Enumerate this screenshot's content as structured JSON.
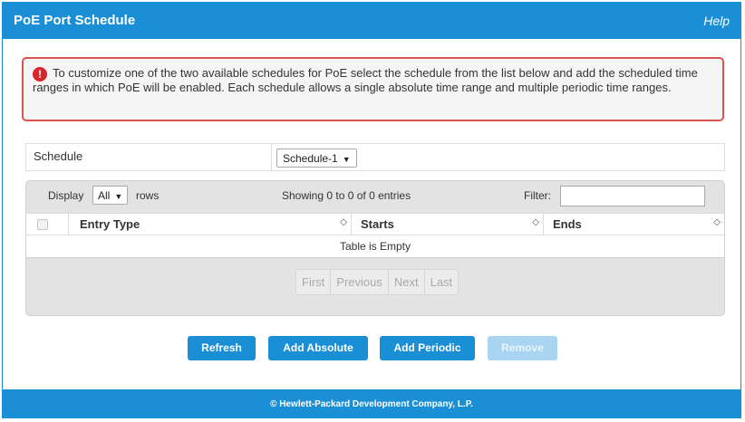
{
  "header": {
    "title": "PoE Port Schedule",
    "help": "Help"
  },
  "alert": {
    "icon": "exclamation-icon",
    "text": "To customize one of the two available schedules for PoE select the schedule from the list below and add the scheduled time ranges in which PoE will be enabled. Each schedule allows a single absolute time range and multiple periodic time ranges."
  },
  "schedule": {
    "label": "Schedule",
    "selected": "Schedule-1"
  },
  "table": {
    "display_label": "Display",
    "display_selected": "All",
    "rows_label": "rows",
    "showing": "Showing 0 to 0 of 0 entries",
    "filter_label": "Filter:",
    "filter_value": "",
    "columns": [
      "Entry Type",
      "Starts",
      "Ends"
    ],
    "empty_text": "Table is Empty",
    "pager": [
      "First",
      "Previous",
      "Next",
      "Last"
    ]
  },
  "buttons": {
    "refresh": "Refresh",
    "add_absolute": "Add Absolute",
    "add_periodic": "Add Periodic",
    "remove": "Remove"
  },
  "footer": {
    "text": "© Hewlett-Packard Development Company, L.P."
  },
  "colors": {
    "accent": "#1a8fd6",
    "alert_border": "#d9534f",
    "alert_icon": "#d9262c"
  }
}
